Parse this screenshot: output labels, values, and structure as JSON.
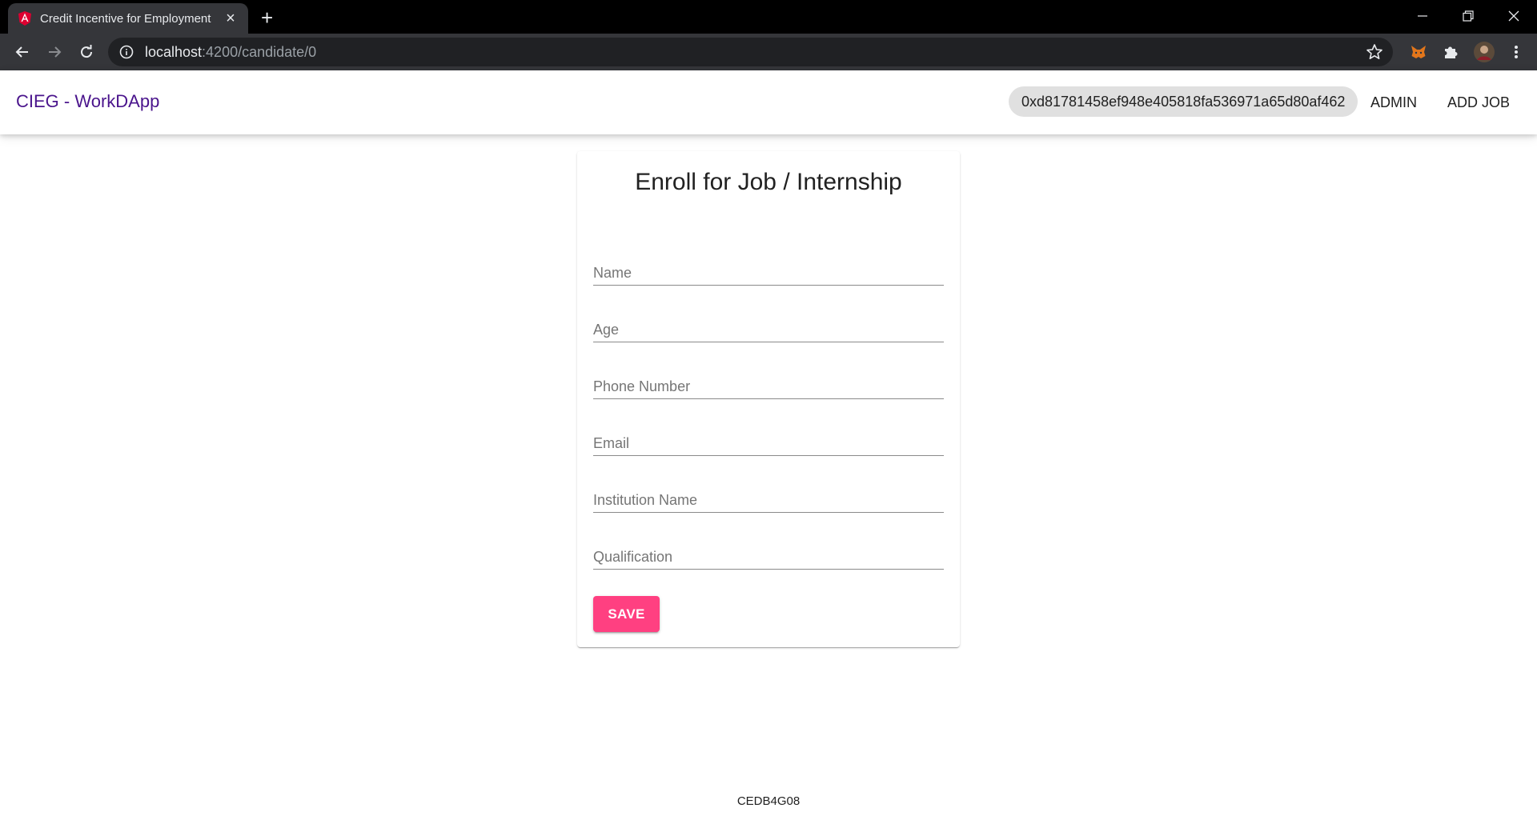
{
  "browser": {
    "tab_title": "Credit Incentive for Employment",
    "url_host": "localhost",
    "url_path": ":4200/candidate/0"
  },
  "header": {
    "brand": "CIEG - WorkDApp",
    "account_address": "0xd81781458ef948e405818fa536971a65d80af462",
    "nav": [
      "ADMIN",
      "ADD JOB"
    ]
  },
  "form": {
    "title": "Enroll for Job / Internship",
    "fields": [
      {
        "placeholder": "Name",
        "value": ""
      },
      {
        "placeholder": "Age",
        "value": ""
      },
      {
        "placeholder": "Phone Number",
        "value": ""
      },
      {
        "placeholder": "Email",
        "value": ""
      },
      {
        "placeholder": "Institution Name",
        "value": ""
      },
      {
        "placeholder": "Qualification",
        "value": ""
      }
    ],
    "save_label": "SAVE"
  },
  "footer": {
    "code": "CEDB4G08"
  },
  "colors": {
    "brand": "#4a148c",
    "accent": "#ff4081",
    "chip_bg": "#e0e0e0",
    "chrome_dark": "#35363a"
  },
  "icons": [
    "angular-favicon-icon",
    "close-icon",
    "plus-icon",
    "back-icon",
    "forward-icon",
    "reload-icon",
    "info-icon",
    "star-icon",
    "metamask-icon",
    "puzzle-icon",
    "avatar",
    "more-vert-icon",
    "minimize-icon",
    "restore-icon"
  ]
}
